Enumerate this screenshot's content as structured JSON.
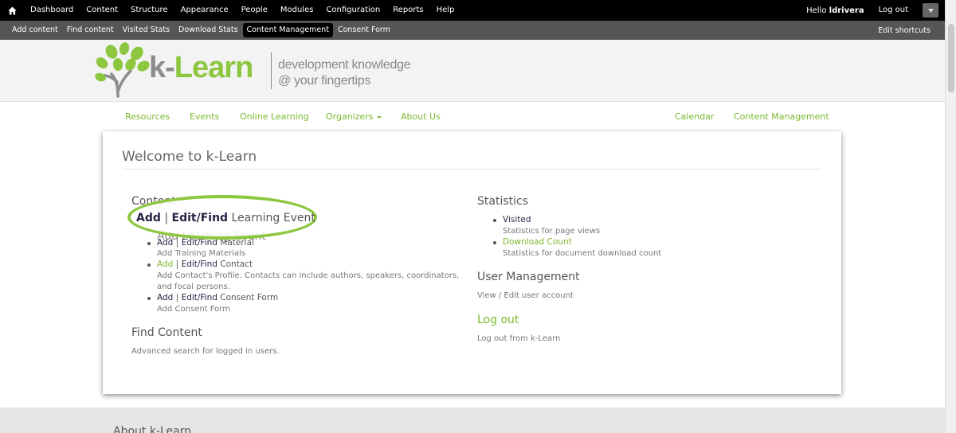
{
  "toolbar": {
    "items": [
      "Dashboard",
      "Content",
      "Structure",
      "Appearance",
      "People",
      "Modules",
      "Configuration",
      "Reports",
      "Help"
    ],
    "hello_prefix": "Hello",
    "username": "ldrivera",
    "logout": "Log out"
  },
  "shortcuts": {
    "items": [
      "Add content",
      "Find content",
      "Visited Stats",
      "Download Stats",
      "Content Management",
      "Consent Form"
    ],
    "active": "Content Management",
    "edit": "Edit shortcuts"
  },
  "header": {
    "brand_k": "k-",
    "brand_learn": "Learn",
    "tagline_1": "development knowledge",
    "tagline_2": "@ your fingertips"
  },
  "nav": {
    "left": [
      "Resources",
      "Events",
      "Online Learning",
      "Organizers",
      "About Us"
    ],
    "right": [
      "Calendar",
      "Content Management"
    ]
  },
  "panel": {
    "title": "Welcome to k-Learn",
    "content_heading": "Content",
    "highlight": {
      "add": "Add",
      "sep": "|",
      "edit": "Edit/Find",
      "rest": "Learning Event"
    },
    "behind_text": "Add Learning Event",
    "items": [
      {
        "add": "Add",
        "edit": "Edit/Find",
        "name": "Material",
        "desc": "Add Training Materials"
      },
      {
        "add": "Add",
        "edit": "Edit/Find",
        "name": "Contact",
        "desc_1": "Add Contact's Profile. Contacts can include authors, speakers, coordinators,",
        "desc_2": "and focal persons."
      },
      {
        "add": "Add",
        "edit": "Edit/Find",
        "name": "Consent Form",
        "desc": "Add Consent Form"
      }
    ],
    "find_heading": "Find Content",
    "find_desc": "Advanced search for logged in users.",
    "stats_heading": "Statistics",
    "stats": [
      {
        "label": "Visited",
        "desc": "Statistics for page views"
      },
      {
        "label": "Download Count",
        "desc": "Statistics for document download count"
      }
    ],
    "user_heading": "User Management",
    "user_desc": "View / Edit user account",
    "logout_heading": "Log out",
    "logout_desc": "Log out from k-Learn"
  },
  "footer": {
    "about": "About k-Learn"
  },
  "colors": {
    "accent_green": "#8dc63f",
    "toolbar_bg": "#000000",
    "shortcut_bg": "#555555"
  }
}
